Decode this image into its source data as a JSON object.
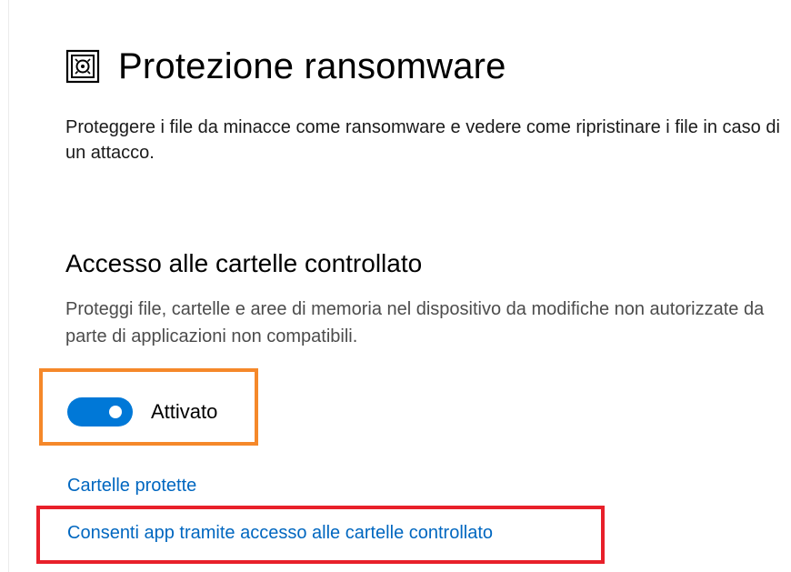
{
  "header": {
    "icon": "ransomware-shield-icon",
    "title": "Protezione ransomware"
  },
  "intro": {
    "text": "Proteggere i file da minacce come ransomware e vedere come ripristinare i file in caso di un attacco."
  },
  "controlled_folder_access": {
    "title": "Accesso alle cartelle controllato",
    "description": "Proteggi file, cartelle e aree di memoria nel dispositivo da modifiche non autorizzate da parte di applicazioni non compatibili.",
    "toggle": {
      "state": "on",
      "label": "Attivato"
    }
  },
  "links": {
    "protected_folders": "Cartelle protette",
    "allow_apps": "Consenti app tramite accesso alle cartelle controllato"
  },
  "annotations": {
    "toggle_box_color": "#f5882a",
    "link_box_color": "#e8202a"
  },
  "colors": {
    "accent": "#0078d7",
    "link": "#0067c0"
  }
}
